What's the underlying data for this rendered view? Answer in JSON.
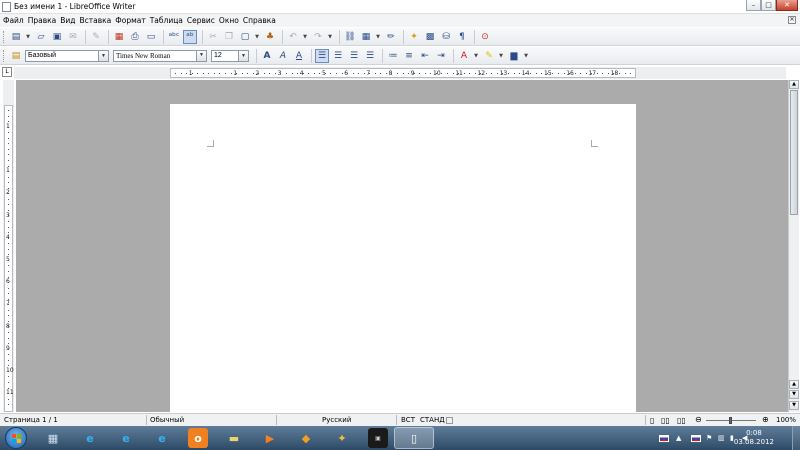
{
  "window": {
    "title": "Без имени 1 - LibreOffice Writer",
    "buttons": {
      "minimize": "–",
      "maximize": "□",
      "close": "✕"
    }
  },
  "menu": {
    "items": [
      "Файл",
      "Правка",
      "Вид",
      "Вставка",
      "Формат",
      "Таблица",
      "Сервис",
      "Окно",
      "Справка"
    ],
    "close": "✕"
  },
  "format_toolbar": {
    "style": "Базовый",
    "font_name": "Times New Roman",
    "font_size": "12"
  },
  "ruler": {
    "h_labels": [
      "1",
      "1",
      "2",
      "3",
      "4",
      "5",
      "6",
      "7",
      "8",
      "9",
      "10",
      "11",
      "12",
      "13",
      "14",
      "15",
      "16",
      "17",
      "18"
    ],
    "v_labels": [
      "1",
      "1",
      "2",
      "3",
      "4",
      "5",
      "6",
      "7",
      "8",
      "9",
      "10",
      "11"
    ],
    "corner": "L"
  },
  "statusbar": {
    "page": "Страница 1 / 1",
    "style": "Обычный",
    "language": "Русский",
    "insert_mode": "ВСТ",
    "selection_mode": "СТАНД",
    "zoom": "100%"
  },
  "taskbar": {
    "time": "0:08",
    "date": "03.08.2012"
  }
}
